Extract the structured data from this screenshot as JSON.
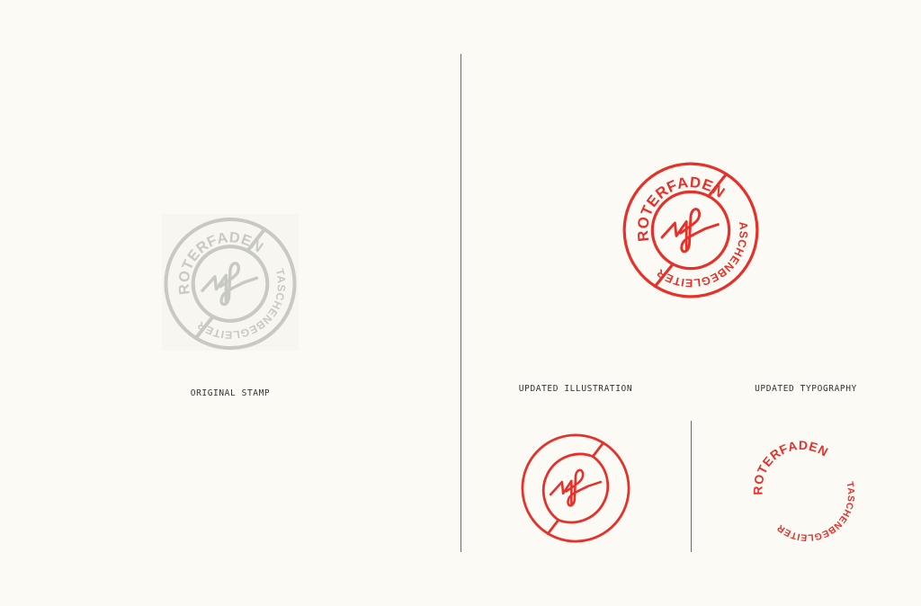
{
  "captions": {
    "original": "ORIGINAL STAMP",
    "illustration": "UPDATED ILLUSTRATION",
    "typography": "UPDATED TYPOGRAPHY"
  },
  "logo_text": {
    "top": "ROTERFADEN",
    "bottom": "TASCHENBEGLEITER"
  },
  "colors": {
    "background": "#fbfaf5",
    "stamp_gray": "#c9c9c4",
    "brand_red": "#e6312b",
    "divider": "#6b6b6b"
  }
}
